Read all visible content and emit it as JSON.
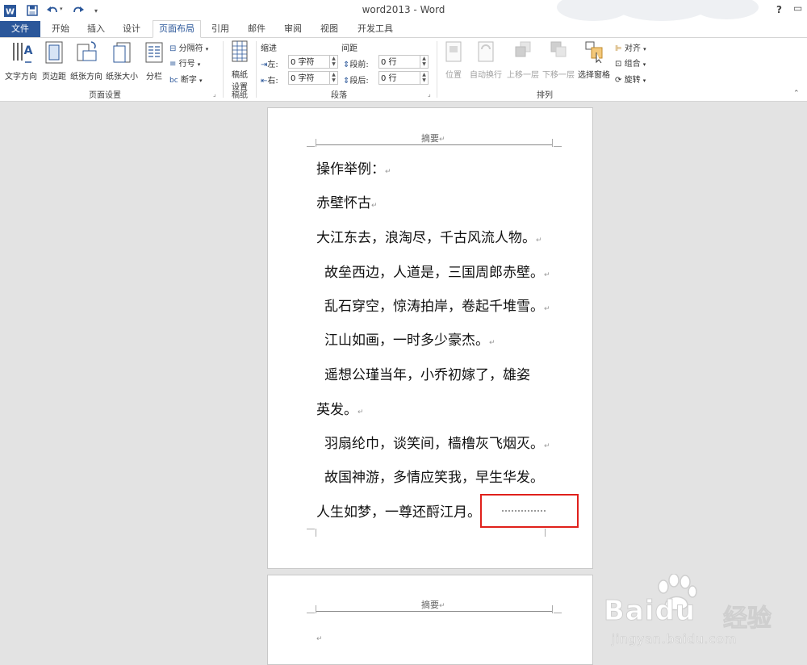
{
  "window": {
    "title": "word2013 - Word",
    "help": "?",
    "accent": "#2b579a"
  },
  "qat": [
    {
      "name": "word-app-icon"
    },
    {
      "name": "save-icon"
    },
    {
      "name": "undo-icon"
    },
    {
      "name": "redo-icon"
    },
    {
      "name": "customize-qat-icon"
    }
  ],
  "tabs": {
    "file": "文件",
    "items": [
      "开始",
      "插入",
      "设计",
      "页面布局",
      "引用",
      "邮件",
      "审阅",
      "视图",
      "开发工具"
    ],
    "active": "页面布局"
  },
  "ribbon": {
    "page_setup": {
      "label": "页面设置",
      "text_direction": "文字方向",
      "margins": "页边距",
      "orientation": "纸张方向",
      "size": "纸张大小",
      "columns": "分栏",
      "breaks": "分隔符",
      "line_numbers": "行号",
      "hyphenation": "断字"
    },
    "draft": {
      "label": "稿纸",
      "button_line1": "稿纸",
      "button_line2": "设置"
    },
    "paragraph": {
      "label": "段落",
      "indent_title": "缩进",
      "spacing_title": "间距",
      "left_label": "左:",
      "right_label": "右:",
      "before_label": "段前:",
      "after_label": "段后:",
      "left_value": "0 字符",
      "right_value": "0 字符",
      "before_value": "0 行",
      "after_value": "0 行"
    },
    "arrange": {
      "label": "排列",
      "position": "位置",
      "wrap_text": "自动换行",
      "bring_forward": "上移一层",
      "send_backward": "下移一层",
      "selection_pane": "选择窗格",
      "align": "对齐",
      "group": "组合",
      "rotate": "旋转"
    }
  },
  "document": {
    "page1": {
      "header": "摘要",
      "paragraphs": [
        "操作举例：",
        "赤壁怀古",
        "大江东去，浪淘尽，千古风流人物。",
        "故垒西边，人道是，三国周郎赤壁。",
        "乱石穿空，惊涛拍岸，卷起千堆雪。",
        "江山如画，一时多少豪杰。",
        "遥想公瑾当年，小乔初嫁了，雄姿",
        "英发。",
        "羽扇纶巾，谈笑间，樯橹灰飞烟灭。",
        "故国神游，多情应笑我，早生华发。",
        "人生如梦，一尊还酹江月。"
      ],
      "paragraph_mark": "↵"
    },
    "page2": {
      "header": "摘要",
      "paragraph_mark": "↵"
    }
  },
  "watermark": {
    "brand": "Baidu",
    "suffix": "经验",
    "url": "jingyan.baidu.com"
  },
  "colors": {
    "highlight_box": "#e0201b"
  }
}
